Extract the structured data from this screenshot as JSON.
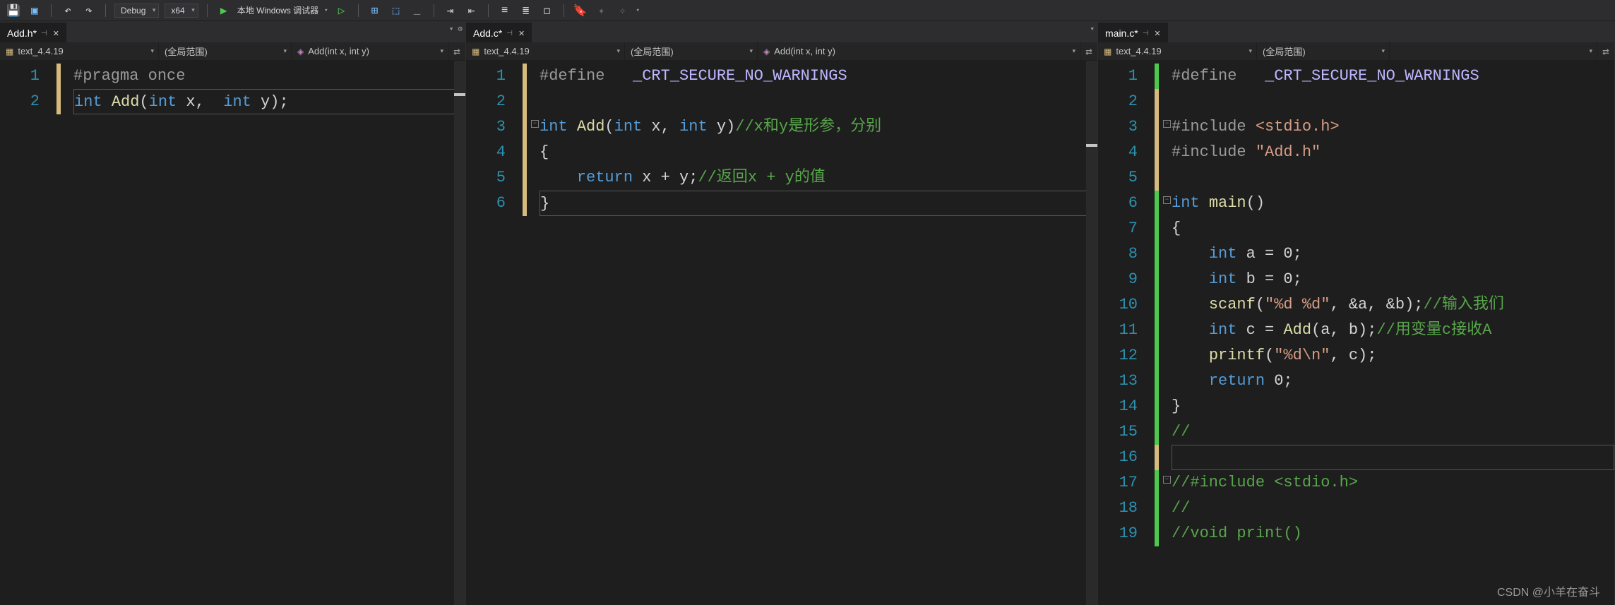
{
  "toolbar": {
    "config": "Debug",
    "platform": "x64",
    "debug_label": "本地 Windows 调试器"
  },
  "panes": [
    {
      "tab": "Add.h*",
      "nav_project": "text_4.4.19",
      "nav_scope": "(全局范围)",
      "nav_func": "Add(int x, int y)",
      "lines": [
        [
          {
            "c": "pp",
            "t": "#pragma "
          },
          {
            "c": "pp",
            "t": "once"
          }
        ],
        [
          {
            "c": "kw",
            "t": "int"
          },
          {
            "c": "txt",
            "t": " "
          },
          {
            "c": "fn",
            "t": "Add"
          },
          {
            "c": "txt",
            "t": "("
          },
          {
            "c": "kw",
            "t": "int"
          },
          {
            "c": "txt",
            "t": " x,  "
          },
          {
            "c": "kw",
            "t": "int"
          },
          {
            "c": "txt",
            "t": " y);"
          }
        ]
      ],
      "line_numbers": [
        "1",
        "2"
      ]
    },
    {
      "tab": "Add.c*",
      "nav_project": "text_4.4.19",
      "nav_scope": "(全局范围)",
      "nav_func": "Add(int x, int y)",
      "lines": [
        [
          {
            "c": "pp",
            "t": "#define   "
          },
          {
            "c": "mac",
            "t": "_CRT_SECURE_NO_WARNINGS"
          }
        ],
        [],
        [
          {
            "c": "kw",
            "t": "int"
          },
          {
            "c": "txt",
            "t": " "
          },
          {
            "c": "fn",
            "t": "Add"
          },
          {
            "c": "txt",
            "t": "("
          },
          {
            "c": "kw",
            "t": "int"
          },
          {
            "c": "txt",
            "t": " x, "
          },
          {
            "c": "kw",
            "t": "int"
          },
          {
            "c": "txt",
            "t": " y)"
          },
          {
            "c": "cmt",
            "t": "//x和y是形参，分别"
          }
        ],
        [
          {
            "c": "txt",
            "t": "{"
          }
        ],
        [
          {
            "c": "txt",
            "t": "    "
          },
          {
            "c": "kw",
            "t": "return"
          },
          {
            "c": "txt",
            "t": " x + y;"
          },
          {
            "c": "cmt",
            "t": "//返回x + y的值"
          }
        ],
        [
          {
            "c": "txt",
            "t": "}"
          }
        ]
      ],
      "line_numbers": [
        "1",
        "2",
        "3",
        "4",
        "5",
        "6"
      ]
    },
    {
      "tab": "main.c*",
      "nav_project": "text_4.4.19",
      "nav_scope": "(全局范围)",
      "nav_func": "",
      "lines": [
        [
          {
            "c": "pp",
            "t": "#define   "
          },
          {
            "c": "mac",
            "t": "_CRT_SECURE_NO_WARNINGS"
          }
        ],
        [],
        [
          {
            "c": "pp",
            "t": "#include "
          },
          {
            "c": "str",
            "t": "<stdio.h>"
          }
        ],
        [
          {
            "c": "pp",
            "t": "#include "
          },
          {
            "c": "str",
            "t": "\"Add.h\""
          }
        ],
        [],
        [
          {
            "c": "kw",
            "t": "int"
          },
          {
            "c": "txt",
            "t": " "
          },
          {
            "c": "fn",
            "t": "main"
          },
          {
            "c": "txt",
            "t": "()"
          }
        ],
        [
          {
            "c": "txt",
            "t": "{"
          }
        ],
        [
          {
            "c": "txt",
            "t": "    "
          },
          {
            "c": "kw",
            "t": "int"
          },
          {
            "c": "txt",
            "t": " a = 0;"
          }
        ],
        [
          {
            "c": "txt",
            "t": "    "
          },
          {
            "c": "kw",
            "t": "int"
          },
          {
            "c": "txt",
            "t": " b = 0;"
          }
        ],
        [
          {
            "c": "txt",
            "t": "    "
          },
          {
            "c": "fn",
            "t": "scanf"
          },
          {
            "c": "txt",
            "t": "("
          },
          {
            "c": "str",
            "t": "\"%d %d\""
          },
          {
            "c": "txt",
            "t": ", &a, &b);"
          },
          {
            "c": "cmt",
            "t": "//输入我们"
          }
        ],
        [
          {
            "c": "txt",
            "t": "    "
          },
          {
            "c": "kw",
            "t": "int"
          },
          {
            "c": "txt",
            "t": " c = "
          },
          {
            "c": "fn",
            "t": "Add"
          },
          {
            "c": "txt",
            "t": "(a, b);"
          },
          {
            "c": "cmt",
            "t": "//用变量c接收A"
          }
        ],
        [
          {
            "c": "txt",
            "t": "    "
          },
          {
            "c": "fn",
            "t": "printf"
          },
          {
            "c": "txt",
            "t": "("
          },
          {
            "c": "str",
            "t": "\"%d\\n\""
          },
          {
            "c": "txt",
            "t": ", c);"
          }
        ],
        [
          {
            "c": "txt",
            "t": "    "
          },
          {
            "c": "kw",
            "t": "return"
          },
          {
            "c": "txt",
            "t": " 0;"
          }
        ],
        [
          {
            "c": "txt",
            "t": "}"
          }
        ],
        [
          {
            "c": "cmt",
            "t": "//"
          }
        ],
        [],
        [
          {
            "c": "cmt",
            "t": "//#include <stdio.h>"
          }
        ],
        [
          {
            "c": "cmt",
            "t": "//"
          }
        ],
        [
          {
            "c": "cmt",
            "t": "//void print()"
          }
        ]
      ],
      "line_numbers": [
        "1",
        "2",
        "3",
        "4",
        "5",
        "6",
        "7",
        "8",
        "9",
        "10",
        "11",
        "12",
        "13",
        "14",
        "15",
        "16",
        "17",
        "18",
        "19"
      ]
    }
  ],
  "watermark": "CSDN @小羊在奋斗"
}
